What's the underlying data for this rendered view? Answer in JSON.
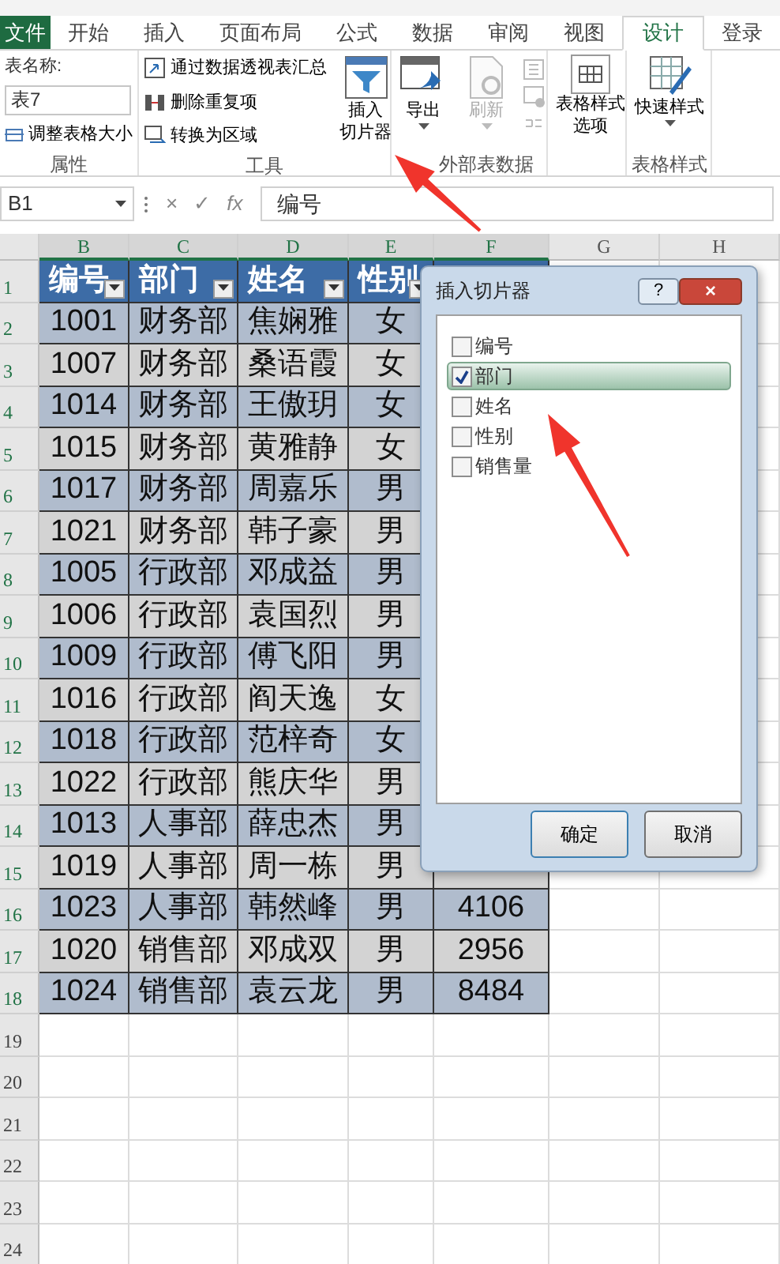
{
  "tabs": [
    {
      "label": "文件",
      "kind": "file",
      "selected": false
    },
    {
      "label": "开始",
      "kind": "tab",
      "selected": false
    },
    {
      "label": "插入",
      "kind": "tab",
      "selected": false
    },
    {
      "label": "页面布局",
      "kind": "tab",
      "selected": false
    },
    {
      "label": "公式",
      "kind": "tab",
      "selected": false
    },
    {
      "label": "数据",
      "kind": "tab",
      "selected": false
    },
    {
      "label": "审阅",
      "kind": "tab",
      "selected": false
    },
    {
      "label": "视图",
      "kind": "tab",
      "selected": false
    },
    {
      "label": "设计",
      "kind": "tab",
      "selected": true
    }
  ],
  "sign_in": "登录",
  "ribbon": {
    "properties": {
      "label": "属性",
      "table_name_label": "表名称:",
      "table_name": "表7",
      "resize": "调整表格大小"
    },
    "tools": {
      "label": "工具",
      "commands": [
        "通过数据透视表汇总",
        "删除重复项",
        "转换为区域"
      ],
      "slicer": [
        "插入",
        "切片器"
      ]
    },
    "external": {
      "label": "外部表数据",
      "export": {
        "label": "导出",
        "disabled": false
      },
      "refresh": {
        "label": "刷新",
        "disabled": true
      }
    },
    "style_options": [
      "表格样式",
      "选项"
    ],
    "styles": {
      "label": "表格样式",
      "quick": "快速样式"
    }
  },
  "formula_bar": {
    "name_box": "B1",
    "buttons": [
      "×",
      "✓",
      "fx"
    ],
    "formula": "编号"
  },
  "columns": [
    "B",
    "C",
    "D",
    "E",
    "F",
    "G",
    "H"
  ],
  "row_numbers": [
    "1",
    "2",
    "3",
    "4",
    "5",
    "6",
    "7",
    "8",
    "9",
    "10",
    "11",
    "12",
    "13",
    "14",
    "15",
    "16",
    "17",
    "18",
    "19",
    "20",
    "21",
    "22",
    "23",
    "24"
  ],
  "table": {
    "headers": [
      "编号",
      "部门",
      "姓名",
      "性别"
    ],
    "rows": [
      {
        "id": "1001",
        "dept": "财务部",
        "name": "焦娴雅",
        "gender": "女"
      },
      {
        "id": "1007",
        "dept": "财务部",
        "name": "桑语霞",
        "gender": "女"
      },
      {
        "id": "1014",
        "dept": "财务部",
        "name": "王傲玥",
        "gender": "女"
      },
      {
        "id": "1015",
        "dept": "财务部",
        "name": "黄雅静",
        "gender": "女"
      },
      {
        "id": "1017",
        "dept": "财务部",
        "name": "周嘉乐",
        "gender": "男"
      },
      {
        "id": "1021",
        "dept": "财务部",
        "name": "韩子豪",
        "gender": "男"
      },
      {
        "id": "1005",
        "dept": "行政部",
        "name": "邓成益",
        "gender": "男"
      },
      {
        "id": "1006",
        "dept": "行政部",
        "name": "袁国烈",
        "gender": "男"
      },
      {
        "id": "1009",
        "dept": "行政部",
        "name": "傅飞阳",
        "gender": "男"
      },
      {
        "id": "1016",
        "dept": "行政部",
        "name": "阎天逸",
        "gender": "女"
      },
      {
        "id": "1018",
        "dept": "行政部",
        "name": "范梓奇",
        "gender": "女"
      },
      {
        "id": "1022",
        "dept": "行政部",
        "name": "熊庆华",
        "gender": "男"
      },
      {
        "id": "1013",
        "dept": "人事部",
        "name": "薛忠杰",
        "gender": "男"
      },
      {
        "id": "1019",
        "dept": "人事部",
        "name": "周一栋",
        "gender": "男"
      },
      {
        "id": "1023",
        "dept": "人事部",
        "name": "韩然峰",
        "gender": "男",
        "column_f": "4106"
      },
      {
        "id": "1020",
        "dept": "销售部",
        "name": "邓成双",
        "gender": "男",
        "column_f": "2956"
      },
      {
        "id": "1024",
        "dept": "销售部",
        "name": "袁云龙",
        "gender": "男",
        "column_f": "8484"
      }
    ]
  },
  "dialog": {
    "title": "插入切片器",
    "title_buttons": [
      "?",
      "×"
    ],
    "fields": [
      {
        "label": "编号",
        "checked": false,
        "selected": false
      },
      {
        "label": "部门",
        "checked": true,
        "selected": true
      },
      {
        "label": "姓名",
        "checked": false,
        "selected": false
      },
      {
        "label": "性别",
        "checked": false,
        "selected": false
      },
      {
        "label": "销售量",
        "checked": false,
        "selected": false
      }
    ],
    "buttons": [
      "确定",
      "取消"
    ]
  }
}
